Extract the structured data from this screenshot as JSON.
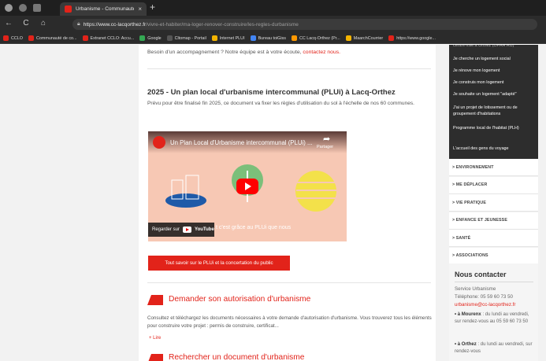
{
  "browser": {
    "tab_title": "Urbanisme - Communauté de co",
    "tab_close": "×",
    "new_tab": "+",
    "back": "←",
    "refresh": "C",
    "home": "⌂",
    "url_host": "https://www.cc-lacqorthez.fr",
    "url_path": "/vivre-et-habiter/ma-loger-renover-construire/les-regles-durbanisme",
    "bookmarks": [
      {
        "label": "CCLO",
        "color": "#e2231a"
      },
      {
        "label": "Communauté de co...",
        "color": "#e2231a"
      },
      {
        "label": "Extranet CCLO: Accu...",
        "color": "#e2231a"
      },
      {
        "label": "Google",
        "color": "#34a853"
      },
      {
        "label": "Cltomap - Portail",
        "color": "#555555"
      },
      {
        "label": "Internet PLUI",
        "color": "#f4b400"
      },
      {
        "label": "Bureau toiGiss",
        "color": "#4285f4"
      },
      {
        "label": "CC Lacq-Orthez (Pr...",
        "color": "#ff9800"
      },
      {
        "label": "MaarchCourrier",
        "color": "#f4b400"
      },
      {
        "label": "https://www.google...",
        "color": "#e2231a"
      }
    ]
  },
  "main": {
    "help_text": "Besoin d'un accompagnement ? Notre équipe est à votre écoute,",
    "help_link": "contactez nous.",
    "plui_title": "2025 - Un plan local d'urbanisme intercommunal (PLUi) à Lacq-Orthez",
    "plui_text": "Prévu pour être finalisé fin 2025, ce document va fixer les règles d'utilisation du sol à l'échelle de nos 60 communes.",
    "video": {
      "title": "Un Plan Local d'Urbanisme intercommunal (PLUi) ...",
      "share_label": "Partager",
      "watch_on": "Regarder sur",
      "yt_brand": "YouTube",
      "caption": "t c'est grâce au PLUi que nous"
    },
    "plui_button": "Tout savoir sur le PLUi et la concertation du public",
    "authorisation_title": "Demander son autorisation d'urbanisme",
    "authorisation_text": "Consultez et téléchargez les documents nécessaires à votre demande d'autorisation d'urbanisme.  Vous trouverez tous les éléments pour construire votre projet : permis de construire, certificat...",
    "authorisation_more": "+ Lire",
    "search_title": "Rechercher un document d'urbanisme"
  },
  "sidebar": {
    "dark_items": [
      "centre-ville à Orthez (OPAH RU)",
      "Je cherche un logement social",
      "Je rénove mon logement",
      "Je construis mon logement",
      "Je souhaite un logement \"adapté\"",
      "J'ai un projet de lotissement ou de groupement d'habitations",
      "Programme local de l'habitat (PLH)",
      "L'accueil des gens du voyage"
    ],
    "sections": [
      "> ENVIRONNEMENT",
      "> ME DÉPLACER",
      "> VIE PRATIQUE",
      "> ENFANCE ET JEUNESSE",
      "> SANTÉ",
      "> ASSOCIATIONS"
    ],
    "contact": {
      "title": "Nous contacter",
      "service": "Service Urbanisme",
      "phone": "Téléphone: 05 59 60 73 50",
      "email": "urbanisme@cc-lacqorthez.fr",
      "mourenx_name": "• à Mourenx",
      "mourenx_text": ": du lundi au vendredi, sur rendez-vous au 05 59 60 73 50",
      "orthez_name": "• à Orthez",
      "orthez_text": ": du lundi au vendredi, sur rendez-vous"
    }
  }
}
